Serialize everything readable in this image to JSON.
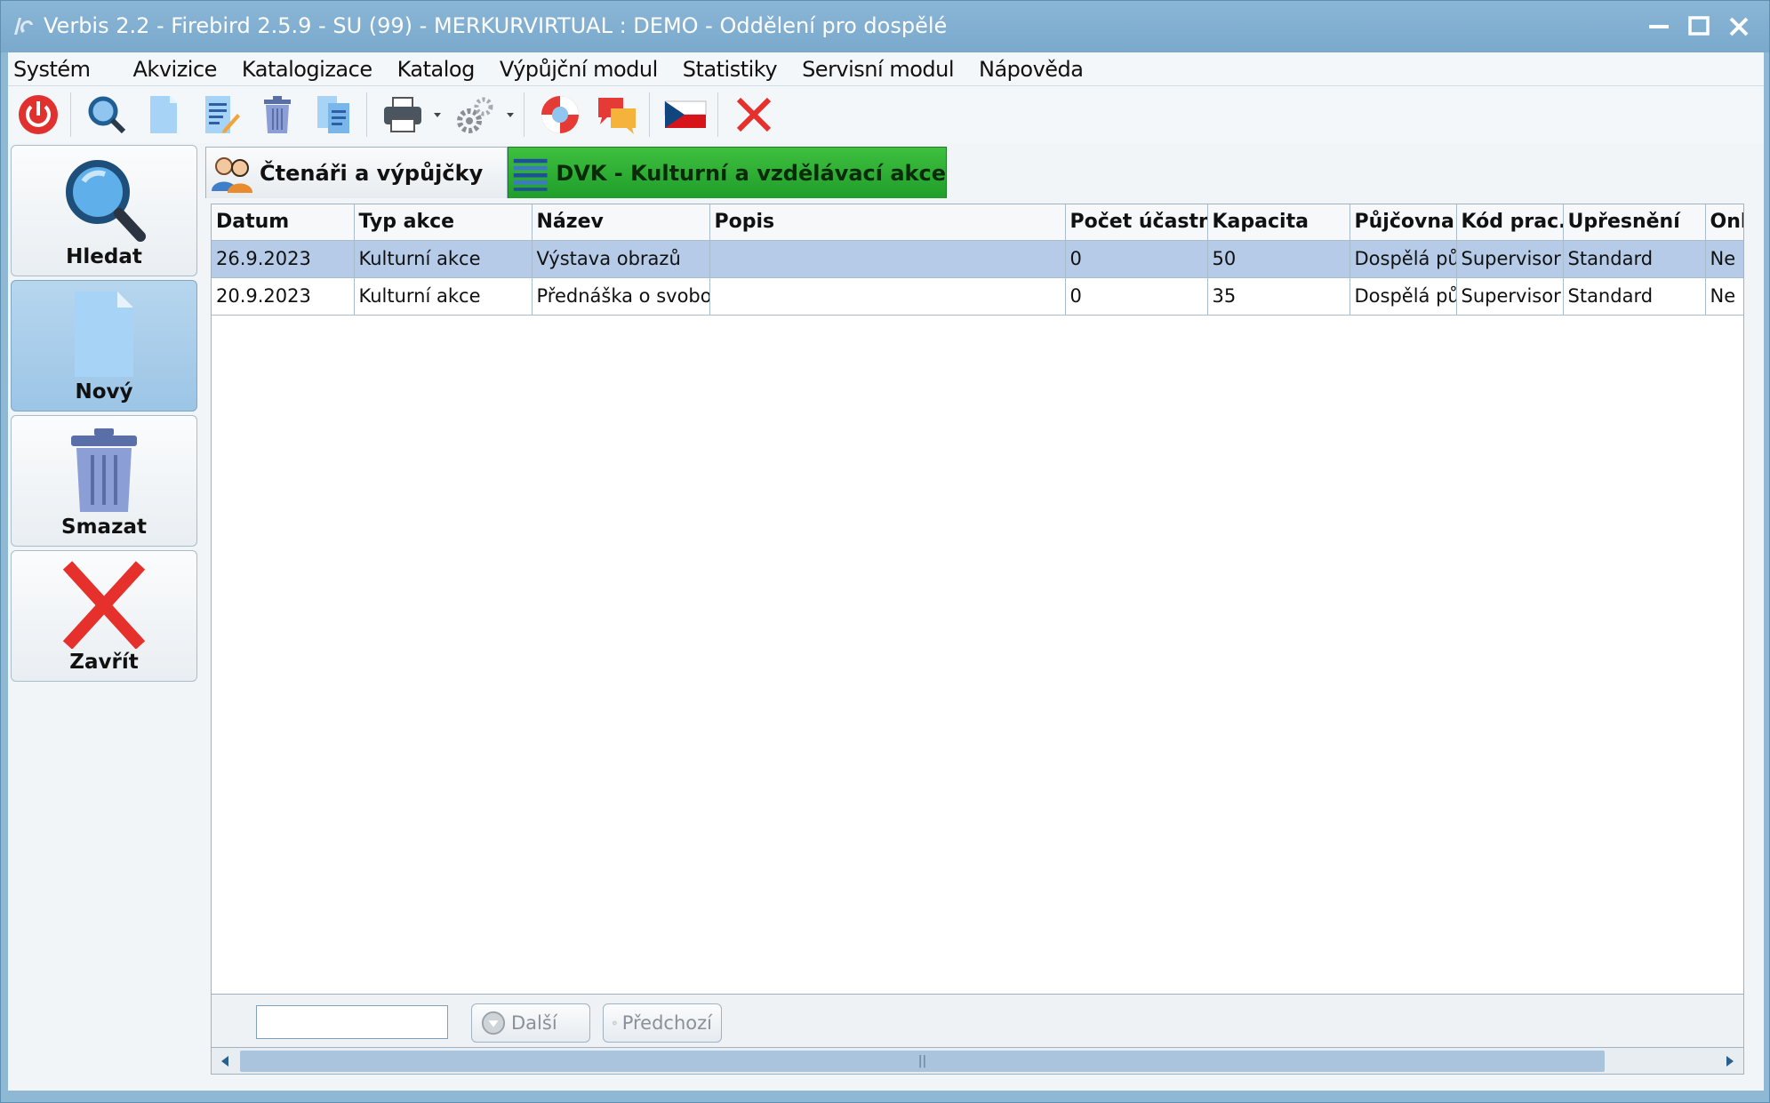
{
  "window": {
    "title": "Verbis 2.2 - Firebird 2.5.9 - SU (99) - MERKURVIRTUAL : DEMO - Oddělení pro dospělé"
  },
  "menu": [
    {
      "label": "Systém"
    },
    {
      "label": "Akvizice"
    },
    {
      "label": "Katalogizace"
    },
    {
      "label": "Katalog"
    },
    {
      "label": "Výpůjční modul"
    },
    {
      "label": "Statistiky"
    },
    {
      "label": "Servisní modul"
    },
    {
      "label": "Nápověda"
    }
  ],
  "toolbar": {
    "icons": [
      "power-icon",
      "search-icon",
      "new-document-icon",
      "edit-icon",
      "trash-icon",
      "copy-document-icon",
      "printer-icon",
      "settings-icon",
      "help-lifebuoy-icon",
      "chat-icon",
      "czech-flag-icon",
      "close-icon"
    ]
  },
  "sidepanel": {
    "search_label": "Hledat",
    "new_label": "Nový",
    "delete_label": "Smazat",
    "close_label": "Zavřít"
  },
  "tabs": {
    "readers": "Čtenáři a výpůjčky",
    "events": "DVK - Kulturní a vzdělávací akce"
  },
  "grid": {
    "columns": [
      "Datum",
      "Typ akce",
      "Název",
      "Popis",
      "Počet účastníků",
      "Kapacita",
      "Půjčovna",
      "Kód prac.",
      "Upřesnění",
      "Online"
    ],
    "rows": [
      {
        "datum": "26.9.2023",
        "typ": "Kulturní akce",
        "nazev": "Výstava obrazů",
        "popis": "",
        "pocet": "0",
        "kapacita": "50",
        "pujcovna": "Dospělá půjčovna",
        "kod": "Supervisor",
        "upresneni": "Standard",
        "online": "Ne"
      },
      {
        "datum": "20.9.2023",
        "typ": "Kulturní akce",
        "nazev": "Přednáška o svobodě",
        "popis": "",
        "pocet": "0",
        "kapacita": "35",
        "pujcovna": "Dospělá půjčovna",
        "kod": "Supervisor",
        "upresneni": "Standard",
        "online": "Ne"
      }
    ]
  },
  "searchbar": {
    "value": "",
    "next_label": "Další",
    "prev_label": "Předchozí"
  },
  "colors": {
    "active_tab": "#2aa835",
    "selected_row": "#b5cbe8",
    "titlebar": "#7fadcf"
  }
}
